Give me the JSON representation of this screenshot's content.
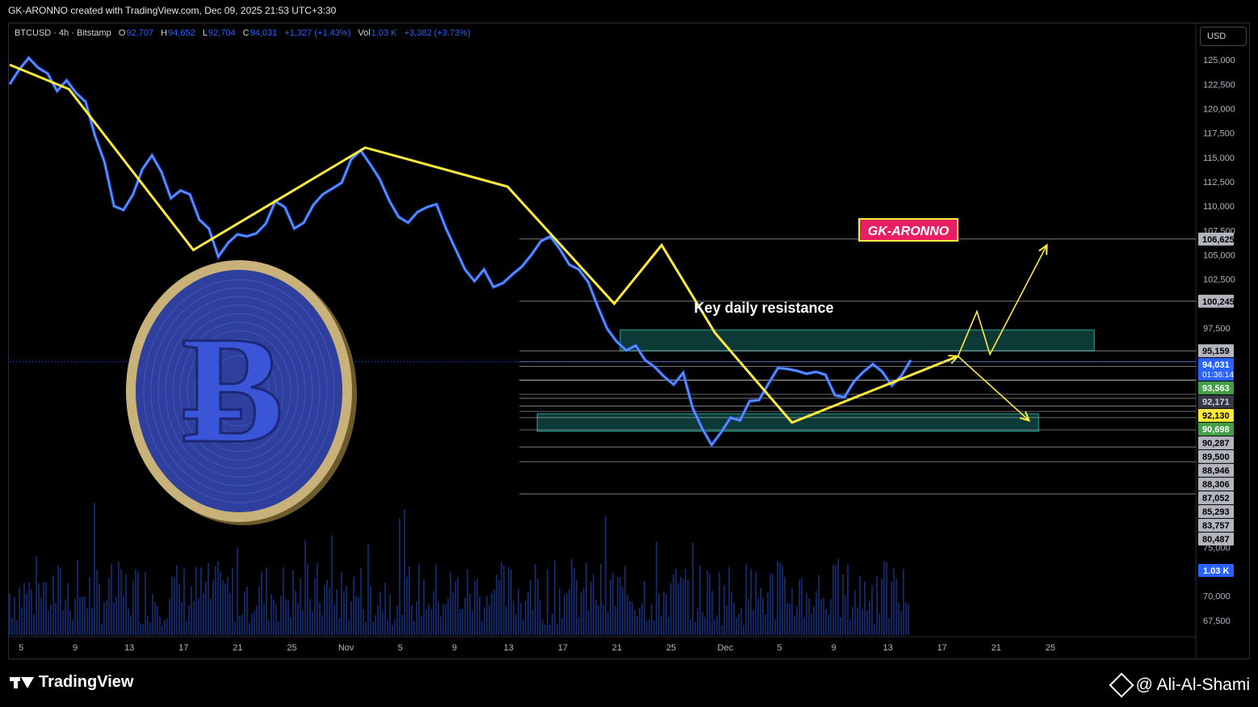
{
  "caption": "GK-ARONNO created with TradingView.com, Dec 09, 2025 21:53 UTC+3:30",
  "symbol_bar": {
    "symbol": "BTCUSD · 4h · Bitstamp",
    "o_label": "O",
    "o": "92,707",
    "h_label": "H",
    "h": "94,652",
    "l_label": "L",
    "l": "92,704",
    "c_label": "C",
    "c": "94,031",
    "change": "+1,327 (+1.43%)",
    "vol_label": "Vol",
    "vol": "1.03 K",
    "vol_change": "+3,382 (+3.73%)"
  },
  "currency_button": "USD",
  "footer": {
    "brand": "TradingView",
    "author": "@ Ali-Al-Shami"
  },
  "colors": {
    "candle": "#2962ff",
    "pattern": "#ffeb3b",
    "zone": "#26a69a",
    "volume": "#2962ff",
    "brand_box": "#e91e63"
  },
  "chart_data": {
    "type": "line",
    "title": "",
    "xlabel": "",
    "ylabel": "",
    "x_ticks": [
      "5",
      "9",
      "13",
      "17",
      "21",
      "25",
      "Nov",
      "5",
      "9",
      "13",
      "17",
      "21",
      "25",
      "Dec",
      "5",
      "9",
      "13",
      "17",
      "21",
      "25"
    ],
    "y_ticks": [
      125000,
      122500,
      120000,
      117500,
      115000,
      112500,
      110000,
      107500,
      105000,
      102500,
      97500,
      75000,
      70000,
      67500
    ],
    "y_tick_labels": [
      "125,000",
      "122,500",
      "120,000",
      "117,500",
      "115,000",
      "112,500",
      "110,000",
      "107,500",
      "105,000",
      "102,500",
      "97,500",
      "75,000",
      "70,000",
      "67,500"
    ],
    "ylim": [
      66000,
      126500
    ],
    "grid": false,
    "series": [
      {
        "values": [
          122500,
          124000,
          125200,
          124200,
          123600,
          121800,
          122900,
          121600,
          120700,
          117200,
          114500,
          110000,
          109600,
          111200,
          113800,
          115200,
          113500,
          110800,
          111600,
          111200,
          108600,
          107700,
          104800,
          106200,
          107100,
          106900,
          107200,
          108200,
          110500,
          109900,
          107700,
          108300,
          110100,
          111200,
          111800,
          112400,
          114800,
          115700,
          114300,
          112800,
          110600,
          108900,
          108300,
          109400,
          109900,
          110200,
          107700,
          105600,
          103500,
          102300,
          103500,
          101700,
          102100,
          103000,
          103800,
          105000,
          106400,
          106900,
          105600,
          104000,
          103500,
          102200,
          99700,
          97400,
          96100,
          95200,
          95700,
          94200,
          93500,
          92500,
          91700,
          92900,
          89300,
          87200,
          85500,
          86800,
          88300,
          88000,
          90000,
          90100,
          91800,
          93400,
          93300,
          93100,
          92800,
          93000,
          92700,
          90600,
          90400,
          92000,
          93000,
          93800,
          93000,
          91600,
          92600,
          94200
        ],
        "hidden_in_legend": true
      }
    ],
    "pattern_path": [
      [
        0,
        124500
      ],
      [
        0.05,
        122000
      ],
      [
        0.155,
        105500
      ],
      [
        0.3,
        116000
      ],
      [
        0.42,
        112000
      ],
      [
        0.51,
        100000
      ],
      [
        0.55,
        106000
      ],
      [
        0.595,
        97000
      ],
      [
        0.66,
        87800
      ],
      [
        0.8,
        94600
      ]
    ],
    "projection_up": [
      [
        0.8,
        94600
      ],
      [
        0.816,
        99200
      ],
      [
        0.827,
        94800
      ],
      [
        0.875,
        106000
      ]
    ],
    "projection_down": [
      [
        0.8,
        94600
      ],
      [
        0.86,
        88000
      ]
    ],
    "levels": [
      {
        "value": 106625,
        "label": "106,625",
        "style": "gray"
      },
      {
        "value": 100245,
        "label": "100,245",
        "style": "gray"
      },
      {
        "value": 95159,
        "label": "95,159",
        "style": "gray"
      },
      {
        "value": 94031,
        "label": "94,031",
        "style": "blue",
        "sub": "01:36:14"
      },
      {
        "value": 93563,
        "label": "93,563",
        "style": "green"
      },
      {
        "value": 92171,
        "label": "92,171",
        "style": "dark"
      },
      {
        "value": 92130,
        "label": "92,130",
        "style": "yellow"
      },
      {
        "value": 90698,
        "label": "90,698",
        "style": "green"
      },
      {
        "value": 90287,
        "label": "90,287",
        "style": "gray"
      },
      {
        "value": 89500,
        "label": "89,500",
        "style": "gray"
      },
      {
        "value": 88946,
        "label": "88,946",
        "style": "gray"
      },
      {
        "value": 88306,
        "label": "88,306",
        "style": "gray"
      },
      {
        "value": 87052,
        "label": "87,052",
        "style": "gray"
      },
      {
        "value": 85293,
        "label": "85,293",
        "style": "gray"
      },
      {
        "value": 83757,
        "label": "83,757",
        "style": "gray"
      },
      {
        "value": 80487,
        "label": "80,487",
        "style": "gray"
      }
    ],
    "zones": [
      {
        "from": 95159,
        "to": 97300,
        "x0": 0.515,
        "x1": 0.915
      },
      {
        "from": 86900,
        "to": 88700,
        "x0": 0.445,
        "x1": 0.868
      }
    ],
    "volume_label": "1.03 K",
    "annotations": [
      "Key daily resistance",
      "GK-ARONNO"
    ]
  }
}
